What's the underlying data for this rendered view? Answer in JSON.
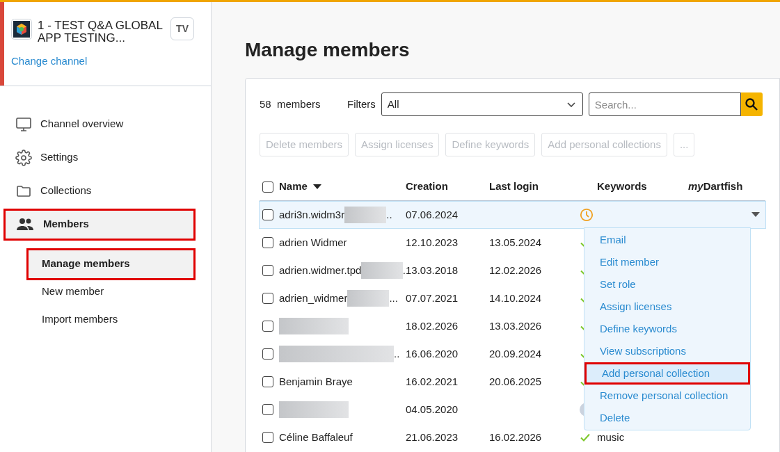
{
  "channel": {
    "name": "1 - TEST Q&A GLOBAL APP TESTING...",
    "badge": "TV",
    "change_link": "Change channel"
  },
  "sidebar": {
    "items": [
      {
        "label": "Channel overview",
        "selected": false,
        "highlighted": false
      },
      {
        "label": "Settings",
        "selected": false,
        "highlighted": false
      },
      {
        "label": "Collections",
        "selected": false,
        "highlighted": false
      },
      {
        "label": "Members",
        "selected": true,
        "highlighted": true,
        "children": [
          {
            "label": "Manage members",
            "selected": true,
            "highlighted": true
          },
          {
            "label": "New member",
            "selected": false,
            "highlighted": false
          },
          {
            "label": "Import members",
            "selected": false,
            "highlighted": false
          }
        ]
      }
    ]
  },
  "page_title": "Manage members",
  "count": {
    "number": "58",
    "label": "members"
  },
  "filters": {
    "label": "Filters",
    "value": "All"
  },
  "search": {
    "placeholder": "Search..."
  },
  "actions": [
    {
      "label": "Delete members",
      "disabled": true
    },
    {
      "label": "Assign licenses",
      "disabled": true
    },
    {
      "label": "Define keywords",
      "disabled": true
    },
    {
      "label": "Add personal collections",
      "disabled": true
    },
    {
      "label": "...",
      "disabled": true
    }
  ],
  "table": {
    "select_all": {
      "checked": false
    },
    "columns": [
      {
        "label": "Name"
      },
      {
        "label": "Creation"
      },
      {
        "label": "Last login"
      },
      {
        "label": "Keywords"
      },
      {
        "italic_part": "my",
        "label": "Dartfish"
      }
    ],
    "rows": [
      {
        "name": "adri3n.widm3r",
        "redacted": true,
        "suffix": "..",
        "creation": "07.06.2024",
        "last_login": "",
        "kind": "pending",
        "keywords": "",
        "expanded": true,
        "checked": false
      },
      {
        "name": "adrien Widmer",
        "redacted": false,
        "suffix": "",
        "creation": "12.10.2023",
        "last_login": "13.05.2024",
        "kind": "check",
        "keywords": "",
        "expanded": false,
        "checked": false
      },
      {
        "name": "adrien.widmer.tpd",
        "redacted": true,
        "suffix": ".",
        "creation": "13.03.2018",
        "last_login": "12.02.2026",
        "kind": "check",
        "keywords": "",
        "expanded": false,
        "checked": false
      },
      {
        "name": "adrien_widmer",
        "redacted": true,
        "suffix": "...",
        "creation": "07.07.2021",
        "last_login": "14.10.2024",
        "kind": "check",
        "keywords": "",
        "expanded": false,
        "checked": false
      },
      {
        "name": "",
        "redacted": true,
        "suffix": "",
        "creation": "18.02.2026",
        "last_login": "13.03.2026",
        "kind": "check",
        "keywords": "",
        "expanded": false,
        "checked": false
      },
      {
        "name": "",
        "redacted": true,
        "suffix": "..",
        "creation": "16.06.2020",
        "last_login": "20.09.2024",
        "kind": "check",
        "keywords": "",
        "expanded": false,
        "checked": false
      },
      {
        "name": "Benjamin Braye",
        "redacted": false,
        "suffix": "",
        "creation": "16.02.2021",
        "last_login": "20.06.2025",
        "kind": "check",
        "keywords": "",
        "expanded": false,
        "checked": false
      },
      {
        "name": "",
        "redacted": true,
        "suffix": "",
        "creation": "04.05.2020",
        "last_login": "",
        "kind": "none",
        "keywords": "",
        "expanded": false,
        "checked": false
      },
      {
        "name": "Céline Baffaleuf",
        "redacted": false,
        "suffix": "",
        "creation": "21.06.2023",
        "last_login": "16.02.2026",
        "kind": "check",
        "keywords": "music",
        "expanded": false,
        "checked": false
      }
    ]
  },
  "row_menu": {
    "items": [
      {
        "label": "Email",
        "highlighted": false
      },
      {
        "label": "Edit member",
        "highlighted": false
      },
      {
        "label": "Set role",
        "highlighted": false
      },
      {
        "label": "Assign licenses",
        "highlighted": false
      },
      {
        "label": "Define keywords",
        "highlighted": false
      },
      {
        "label": "View subscriptions",
        "highlighted": false
      },
      {
        "label": "Add personal collection",
        "highlighted": true
      },
      {
        "label": "Remove personal collection",
        "highlighted": false
      },
      {
        "label": "Delete",
        "highlighted": false
      }
    ]
  }
}
